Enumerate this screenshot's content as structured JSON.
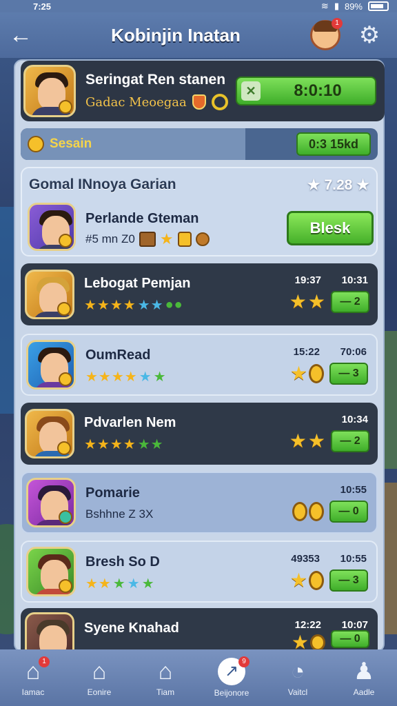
{
  "status_bar": {
    "time": "7:25",
    "battery": "89%"
  },
  "header": {
    "title": "Kobinjin Inatan",
    "back_icon": "arrow-left-icon",
    "notif_count": "1"
  },
  "profile": {
    "name": "Seringat Ren stanen",
    "subtitle": "Gadac Meoegaa",
    "timer": "8:0:10"
  },
  "session": {
    "label": "Sesain",
    "value": "0:3 15kd"
  },
  "group": {
    "title": "Gomal INnoya Garian",
    "rating": "7.28",
    "player_name": "Perlande Gteman",
    "player_sub": "#5 mn Z0",
    "action_label": "Blesk"
  },
  "rows": [
    {
      "name": "Lebogat Pemjan",
      "time1": "19:37",
      "time2": "10:31",
      "btn": "2",
      "style": "dark"
    },
    {
      "name": "OumRead",
      "time1": "15:22",
      "time2": "70:06",
      "btn": "3",
      "style": "light"
    },
    {
      "name": "Pdvarlen Nem",
      "time1": "",
      "time2": "10:34",
      "btn": "2",
      "style": "dark"
    },
    {
      "name": "Pomarie",
      "sub": "Bshhne Z 3X",
      "time1": "",
      "time2": "10:55",
      "btn": "0",
      "style": "mid"
    },
    {
      "name": "Bresh So D",
      "time1": "49353",
      "time2": "10:55",
      "btn": "3",
      "style": "light"
    },
    {
      "name": "Syene Knahad",
      "time1": "12:22",
      "time2": "10:07",
      "btn": "0",
      "style": "dark"
    }
  ],
  "tabs": [
    {
      "label": "Iamac",
      "icon": "home-icon",
      "badge": "1"
    },
    {
      "label": "Eonire",
      "icon": "shop-icon"
    },
    {
      "label": "Tiam",
      "icon": "house-icon"
    },
    {
      "label": "Beijonore",
      "icon": "arrow-icon",
      "badge": "9"
    },
    {
      "label": "Vaitcl",
      "icon": "globe-icon"
    },
    {
      "label": "Aadle",
      "icon": "person-icon"
    }
  ]
}
